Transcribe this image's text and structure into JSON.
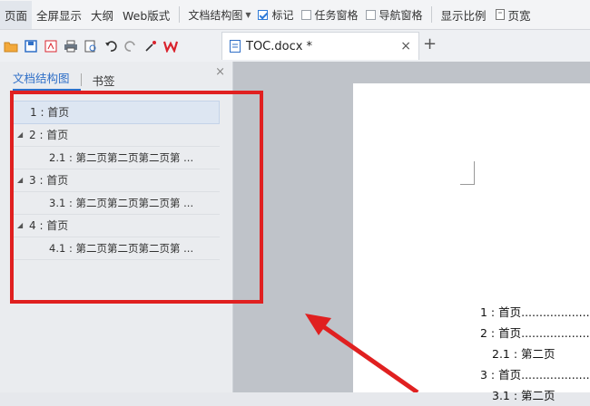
{
  "menubar": {
    "items": [
      "页面",
      "全屏显示",
      "大纲",
      "Web版式"
    ],
    "docmap_dropdown": "文档结构图",
    "checks": [
      {
        "label": "标记",
        "checked": true
      },
      {
        "label": "任务窗格",
        "checked": false
      },
      {
        "label": "导航窗格",
        "checked": false
      }
    ],
    "zoom_label": "显示比例",
    "page_width_label": "页宽"
  },
  "tab": {
    "title": "TOC.docx *",
    "close": "×",
    "plus": "+"
  },
  "navpane": {
    "tabs": [
      "文档结构图",
      "书签"
    ],
    "close": "×",
    "nodes": [
      {
        "text": "1 : 首页",
        "level": 1,
        "selected": true,
        "expander": ""
      },
      {
        "text": "2 : 首页",
        "level": 1,
        "selected": false,
        "expander": "◢"
      },
      {
        "text": "2.1 : 第二页第二页第二页第 ...",
        "level": 2,
        "selected": false,
        "expander": ""
      },
      {
        "text": "3 : 首页",
        "level": 1,
        "selected": false,
        "expander": "◢"
      },
      {
        "text": "3.1 : 第二页第二页第二页第 ...",
        "level": 2,
        "selected": false,
        "expander": ""
      },
      {
        "text": "4 : 首页",
        "level": 1,
        "selected": false,
        "expander": "◢"
      },
      {
        "text": "4.1 : 第二页第二页第二页第 ...",
        "level": 2,
        "selected": false,
        "expander": ""
      }
    ]
  },
  "document": {
    "toc": [
      {
        "text": "1 : 首页..............................",
        "level": 1
      },
      {
        "text": "2 : 首页..............................",
        "level": 1
      },
      {
        "text": "2.1 : 第二页",
        "level": 2
      },
      {
        "text": "3 : 首页..............................",
        "level": 1
      },
      {
        "text": "3.1 : 第二页",
        "level": 2
      }
    ]
  },
  "colors": {
    "highlight": "#e02020",
    "accent": "#2f6fc7",
    "wps_red": "#d9232d"
  }
}
